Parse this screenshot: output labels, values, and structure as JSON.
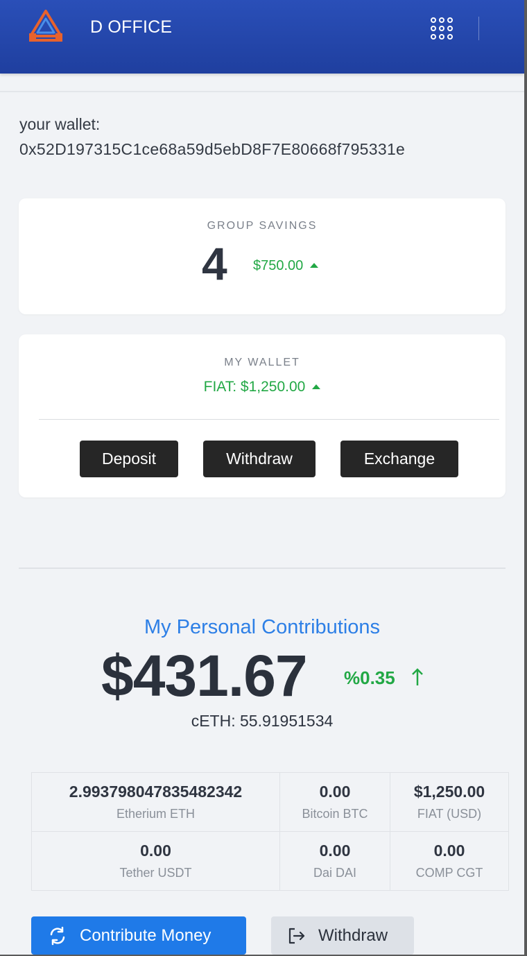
{
  "header": {
    "title": "D OFFICE",
    "logo_icon": "triangle-logo-icon",
    "menu_icon": "apps-grid-icon"
  },
  "wallet": {
    "label": "your wallet:",
    "address": "0x52D197315C1ce68a59d5ebD8F7E80668f795331e"
  },
  "group_savings": {
    "heading": "GROUP SAVINGS",
    "count": "4",
    "amount": "$750.00",
    "trend": "up"
  },
  "my_wallet": {
    "heading": "MY WALLET",
    "fiat": "FIAT: $1,250.00",
    "trend": "up",
    "buttons": {
      "deposit": "Deposit",
      "withdraw": "Withdraw",
      "exchange": "Exchange"
    }
  },
  "contributions": {
    "title": "My Personal Contributions",
    "amount": "$431.67",
    "change": "%0.35",
    "trend": "up",
    "ceth": "cETH: 55.91951534"
  },
  "balances": [
    [
      {
        "value": "2.993798047835482342",
        "label": "Etherium ETH"
      },
      {
        "value": "0.00",
        "label": "Bitcoin BTC"
      },
      {
        "value": "$1,250.00",
        "label": "FIAT (USD)"
      }
    ],
    [
      {
        "value": "0.00",
        "label": "Tether USDT"
      },
      {
        "value": "0.00",
        "label": "Dai DAI"
      },
      {
        "value": "0.00",
        "label": "COMP CGT"
      }
    ]
  ],
  "actions": {
    "contribute": "Contribute Money",
    "contribute_icon": "refresh-icon",
    "withdraw": "Withdraw",
    "withdraw_icon": "logout-icon"
  },
  "colors": {
    "header": "#2a4fb8",
    "accent_blue": "#1f7ae8",
    "positive_green": "#22a845",
    "dark_button": "#262626"
  }
}
